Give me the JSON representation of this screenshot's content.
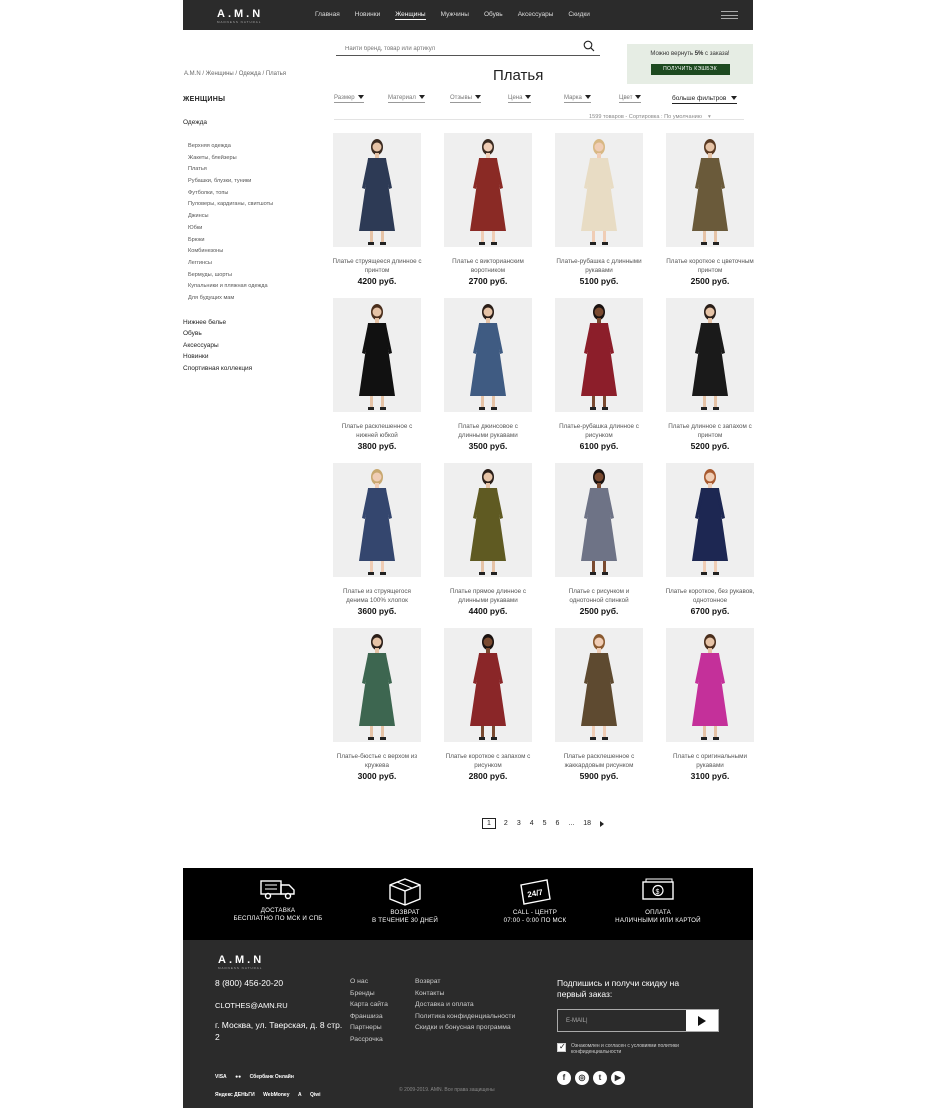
{
  "header": {
    "logo": "A.M.N",
    "logo_sub": "MADNESS NATURAL",
    "nav": [
      "Главная",
      "Новинки",
      "Женщины",
      "Мужчины",
      "Обувь",
      "Аксессуары",
      "Скидки"
    ],
    "active_nav": "Женщины",
    "menu_icon": "hamburger-icon"
  },
  "search": {
    "placeholder": "Найти бренд, товар или артикул",
    "icon": "search-icon"
  },
  "cashback": {
    "text_pre": "Можно вернуть ",
    "percent": "5%",
    "text_post": " с заказа!",
    "button": "ПОЛУЧИТЬ КЭШБЭК"
  },
  "breadcrumb": "A.M.N / Женщины / Одежда / Платья",
  "page_title": "Платья",
  "sidebar": {
    "heading": "ЖЕНЩИНЫ",
    "section": "Одежда",
    "items": [
      "Верхняя одежда",
      "Жакеты, блейзеры",
      "Платья",
      "Рубашки, блузки, туники",
      "Футболки, топы",
      "Пуловеры, кардиганы, свитшоты",
      "Джинсы",
      "Юбки",
      "Брюки",
      "Комбинезоны",
      "Леггинсы",
      "Бермуды, шорты",
      "Купальники и пляжная одежда",
      "Для будущих мам"
    ],
    "other": [
      "Нижнее белье",
      "Обувь",
      "Аксессуары",
      "Новинки",
      "Спортивная коллекция"
    ]
  },
  "filters": [
    "Размер",
    "Материал",
    "Отзывы",
    "Цена",
    "Марка",
    "Цвет"
  ],
  "more_filters": "больше фильтров",
  "sort_text": "1599 товаров - Сортировка : По умолчанию",
  "products": [
    {
      "name": "Платье струящееся длинное с принтом",
      "price": "4200 руб.",
      "dress": "#2d3a55",
      "skin": "#e6c3a6",
      "hair": "#3a2a20"
    },
    {
      "name": "Платье с викторианским воротником",
      "price": "2700 руб.",
      "dress": "#8a2a25",
      "skin": "#f0cdb5",
      "hair": "#3a2a20"
    },
    {
      "name": "Платье-рубашка с длинными рукавами",
      "price": "5100 руб.",
      "dress": "#e8dcc4",
      "skin": "#f0cdb5",
      "hair": "#d8b884"
    },
    {
      "name": "Платье короткое с цветочным принтом",
      "price": "2500 руб.",
      "dress": "#6a5a3a",
      "skin": "#e6c3a6",
      "hair": "#5a3a22"
    },
    {
      "name": "Платье расклешенное с нижней юбкой",
      "price": "3800 руб.",
      "dress": "#111111",
      "skin": "#e6c3a6",
      "hair": "#4a2e1c"
    },
    {
      "name": "Платье джинсовое с длинными рукавами",
      "price": "3500 руб.",
      "dress": "#3f5b82",
      "skin": "#e6c3a6",
      "hair": "#2a1e18"
    },
    {
      "name": "Платье-рубашка длинное с рисунком",
      "price": "6100 руб.",
      "dress": "#8c1e2a",
      "skin": "#7a4a30",
      "hair": "#1a1210"
    },
    {
      "name": "Платье длинное с запахом с принтом",
      "price": "5200 руб.",
      "dress": "#1a1a1a",
      "skin": "#e6c3a6",
      "hair": "#2a1e18"
    },
    {
      "name": "Платье из струящегося денима 100% хлопок",
      "price": "3600 руб.",
      "dress": "#34466e",
      "skin": "#f0cdb5",
      "hair": "#c8a870"
    },
    {
      "name": "Платье прямое длинное с длинными рукавами",
      "price": "4400 руб.",
      "dress": "#5f5a22",
      "skin": "#e6c3a6",
      "hair": "#2a1e18"
    },
    {
      "name": "Платье с рисунком и однотонной спинкой",
      "price": "2500 руб.",
      "dress": "#6e7386",
      "skin": "#7a4a30",
      "hair": "#1a1210"
    },
    {
      "name": "Платье короткое, без рукавов, однотонное",
      "price": "6700 руб.",
      "dress": "#1d2752",
      "skin": "#f0cdb5",
      "hair": "#a85a30"
    },
    {
      "name": "Платье-бюстье с верхом из кружева",
      "price": "3000 руб.",
      "dress": "#3d6650",
      "skin": "#e6c3a6",
      "hair": "#2a1e18"
    },
    {
      "name": "Платье короткое с запахом с рисунком",
      "price": "2800 руб.",
      "dress": "#8a2628",
      "skin": "#7a4a30",
      "hair": "#1a1210"
    },
    {
      "name": "Платье расклешенное с жаккардовым рисунком",
      "price": "5900 руб.",
      "dress": "#5e4a30",
      "skin": "#f0cdb5",
      "hair": "#8a5a30"
    },
    {
      "name": "Платье с оригинальными рукавами",
      "price": "3100 руб.",
      "dress": "#c4309a",
      "skin": "#e6c3a6",
      "hair": "#4a2e1c"
    }
  ],
  "pagination": {
    "current": "1",
    "pages": [
      "2",
      "3",
      "4",
      "5",
      "6"
    ],
    "ellipsis": "...",
    "last": "18"
  },
  "services": [
    {
      "icon": "truck-icon",
      "line1": "ДОСТАВКА",
      "line2": "БЕСПЛАТНО ПО МСК И СПБ"
    },
    {
      "icon": "box-icon",
      "line1": "ВОЗВРАТ",
      "line2": "В ТЕЧЕНИЕ 30 ДНЕЙ"
    },
    {
      "icon": "24-7-icon",
      "line1": "CALL - ЦЕНТР",
      "line2": "07:00 - 0:00 ПО МСК"
    },
    {
      "icon": "money-icon",
      "line1": "ОПЛАТА",
      "line2": "НАЛИЧНЫМИ ИЛИ КАРТОЙ"
    }
  ],
  "footer": {
    "logo": "A.M.N",
    "logo_sub": "MADNESS NATURAL",
    "phone": "8 (800) 456-20-20",
    "email": "CLOTHES@AMN.RU",
    "address": "г. Москва, ул. Тверская, д. 8 стр. 2",
    "col1": [
      "О нас",
      "Бренды",
      "Карта сайта",
      "Франшиза",
      "Партнеры",
      "Рассрочка"
    ],
    "col2": [
      "Возврат",
      "Контакты",
      "Доставка и оплата",
      "Политика конфиденциальности",
      "Скидки и бонусная программа"
    ],
    "subscribe_title": "Подпишись и получи скидку на первый заказ:",
    "email_placeholder": "E-MAIL|",
    "agree_text": "Ознакомлен и согласен с условиями политики конфиденциальности",
    "social": [
      "f",
      "◎",
      "t",
      "▶"
    ],
    "payments": [
      "VISA",
      "●●",
      "Сбербанк Онлайн",
      "Яндекс ДЕНЬГИ",
      "WebMoney",
      "А",
      "Qiwi"
    ],
    "copyright": "© 2009-2019. AMN. Все права защищены"
  }
}
